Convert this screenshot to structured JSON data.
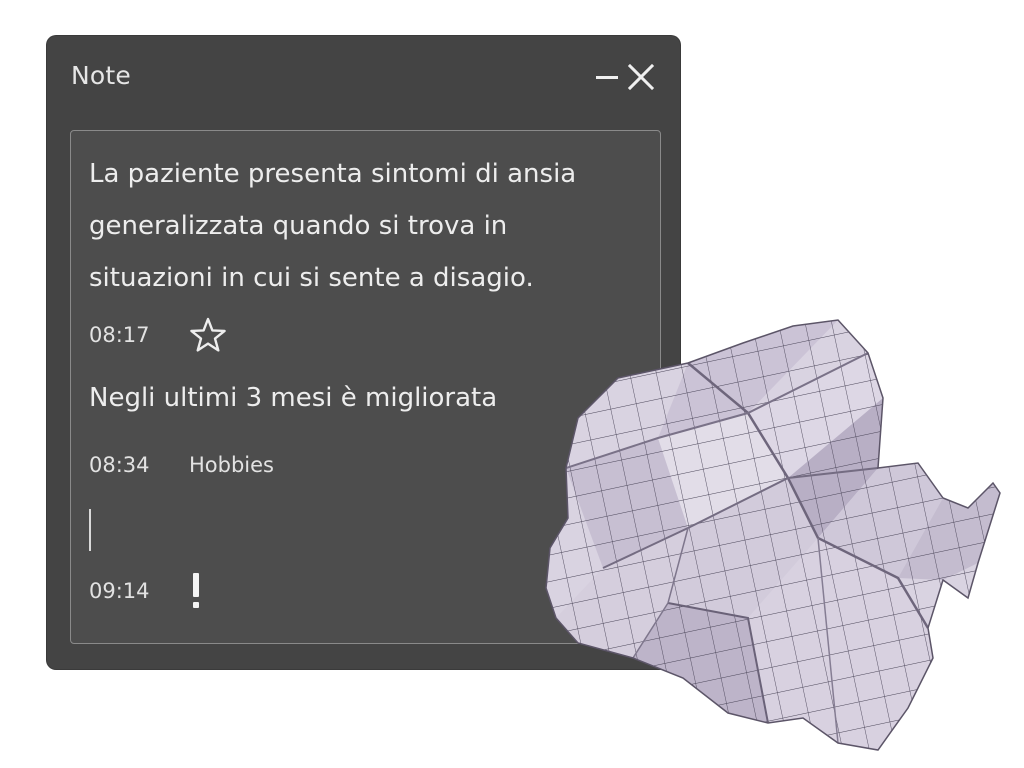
{
  "window": {
    "title": "Note",
    "minimize_icon": "minimize-icon",
    "close_icon": "close-icon"
  },
  "notes": [
    {
      "lines": [
        "La paziente presenta sintomi di ansia",
        "generalizzata quando si trova in",
        "situazioni in cui si sente a disagio."
      ],
      "time": "08:17",
      "marker_icon": "star-outline-icon"
    },
    {
      "text": "Negli ultimi 3 mesi è migliorata",
      "time": "08:34",
      "tag": "Hobbies"
    },
    {
      "text": "",
      "time": "09:14",
      "marker_icon": "exclamation-icon"
    }
  ],
  "decoration": {
    "image": "crumpled-paper-ball",
    "colors": {
      "paper": "#d8d2e0",
      "shadow": "#8a8396",
      "grid": "#4a4558"
    }
  },
  "colors": {
    "window_bg": "#444444",
    "content_bg": "#4d4d4d",
    "text": "#ededed",
    "border": "#8a8a8a"
  }
}
